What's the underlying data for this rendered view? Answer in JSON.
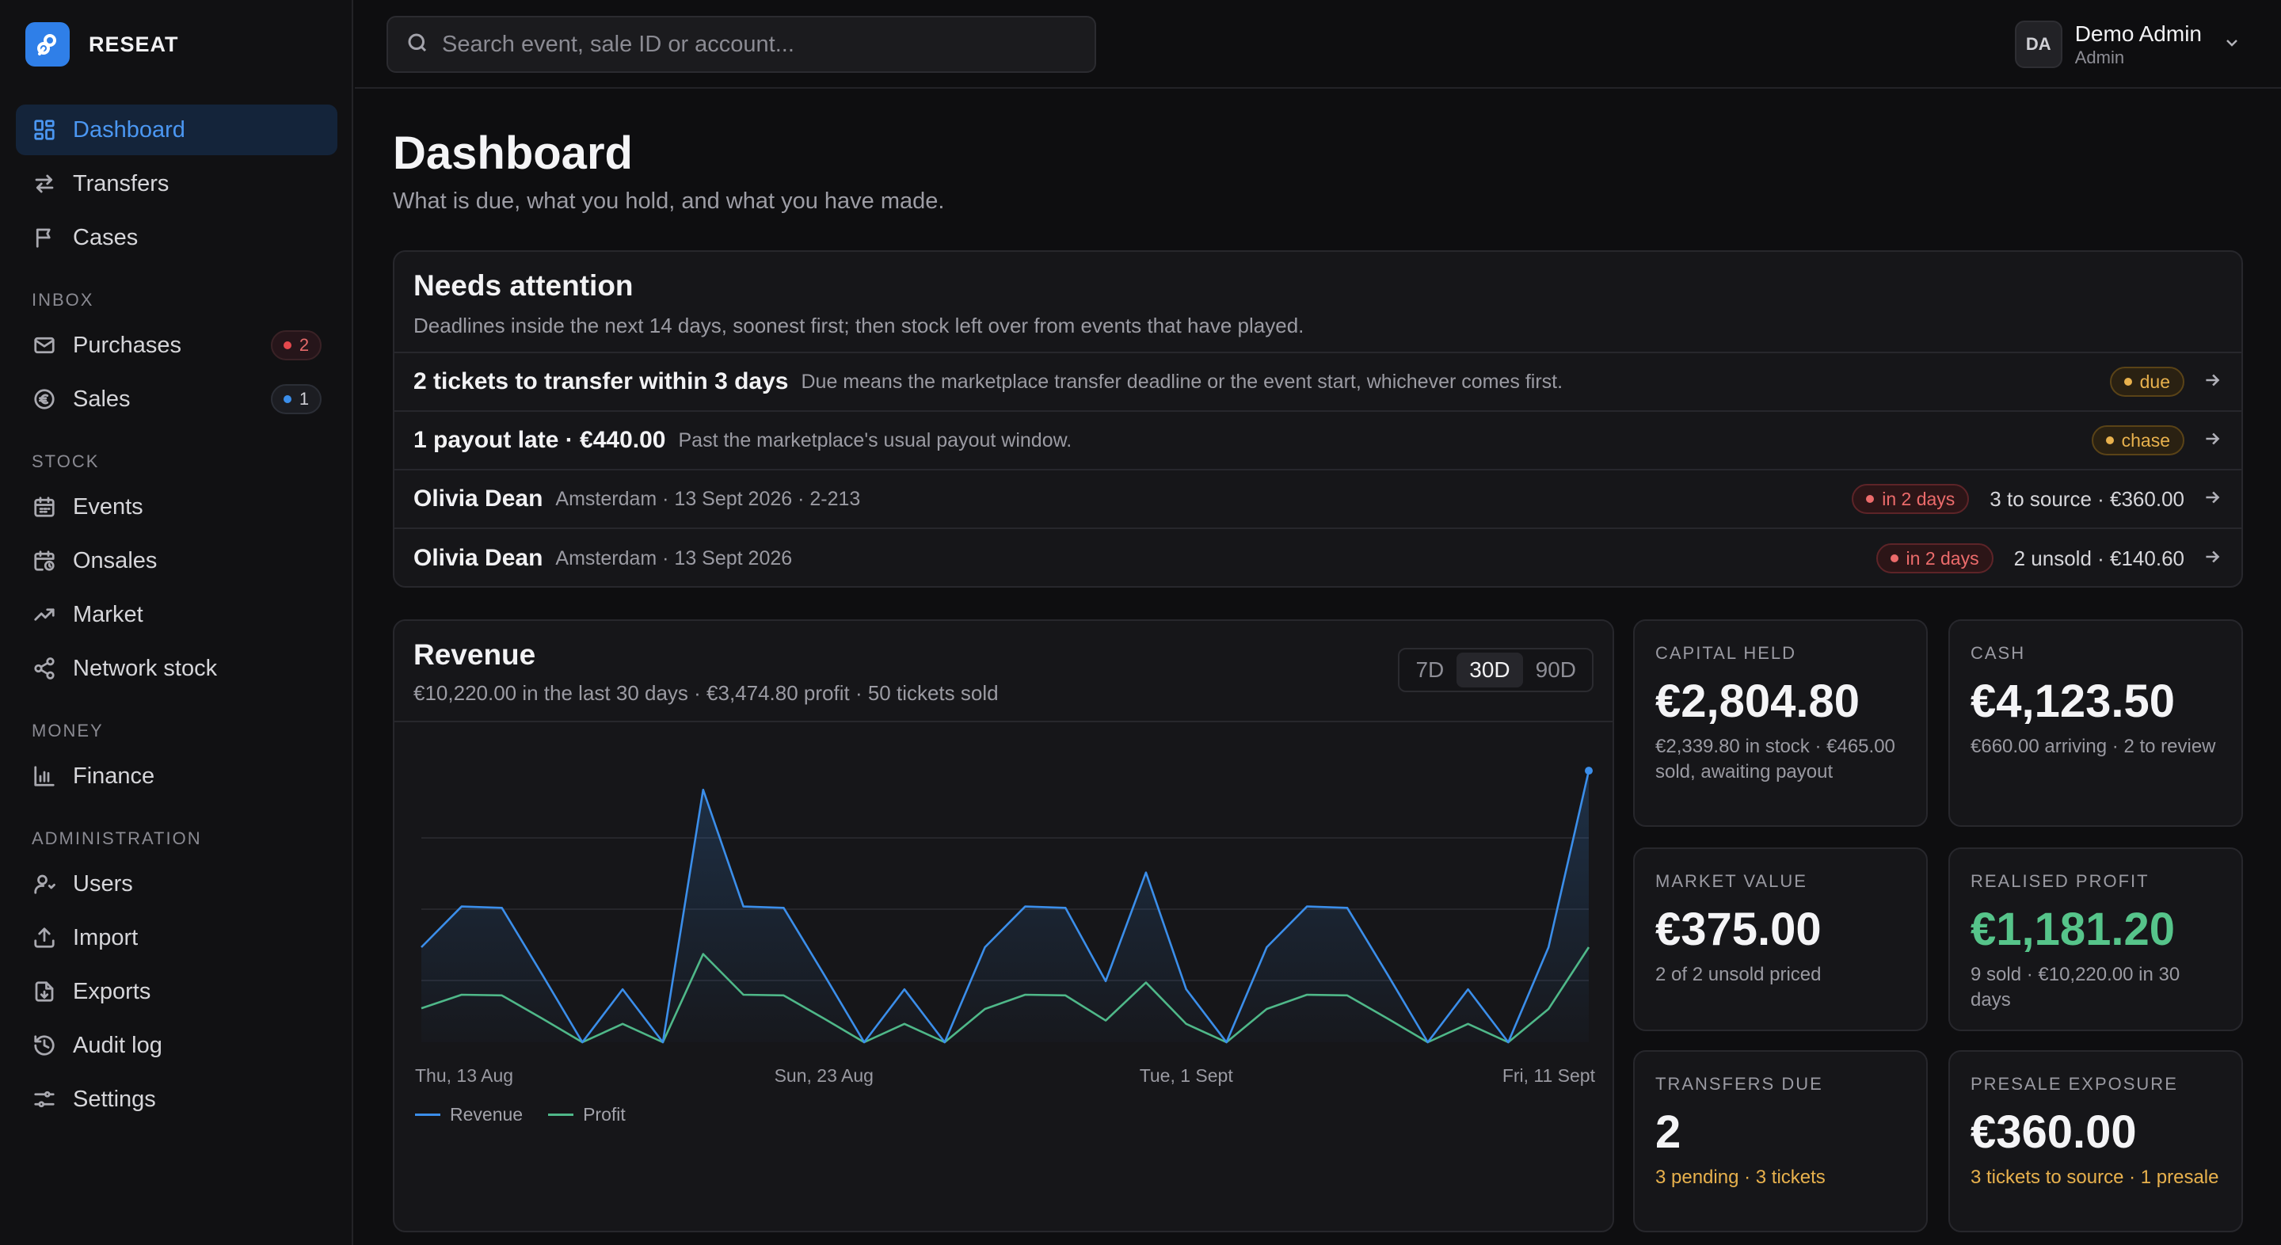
{
  "brand": {
    "name": "RESEAT"
  },
  "search": {
    "placeholder": "Search event, sale ID or account..."
  },
  "user": {
    "initials": "DA",
    "name": "Demo Admin",
    "role": "Admin"
  },
  "sidebar": {
    "top": [
      {
        "label": "Dashboard",
        "icon": "dashboard-icon",
        "active": true
      },
      {
        "label": "Transfers",
        "icon": "transfer-icon"
      },
      {
        "label": "Cases",
        "icon": "flag-icon"
      }
    ],
    "inbox_label": "INBOX",
    "inbox": [
      {
        "label": "Purchases",
        "icon": "mail-icon",
        "badge": "2",
        "badge_color": "#e5484d"
      },
      {
        "label": "Sales",
        "icon": "euro-icon",
        "badge": "1",
        "badge_color": "#3b8eea"
      }
    ],
    "stock_label": "STOCK",
    "stock": [
      {
        "label": "Events",
        "icon": "calendar-icon"
      },
      {
        "label": "Onsales",
        "icon": "calendar-clock-icon"
      },
      {
        "label": "Market",
        "icon": "trend-icon"
      },
      {
        "label": "Network stock",
        "icon": "share-icon"
      }
    ],
    "money_label": "MONEY",
    "money": [
      {
        "label": "Finance",
        "icon": "bar-chart-icon"
      }
    ],
    "admin_label": "ADMINISTRATION",
    "admin": [
      {
        "label": "Users",
        "icon": "users-icon"
      },
      {
        "label": "Import",
        "icon": "upload-icon"
      },
      {
        "label": "Exports",
        "icon": "file-icon"
      },
      {
        "label": "Audit log",
        "icon": "history-icon"
      },
      {
        "label": "Settings",
        "icon": "sliders-icon"
      }
    ]
  },
  "page": {
    "title": "Dashboard",
    "subtitle": "What is due, what you hold, and what you have made."
  },
  "attention": {
    "title": "Needs attention",
    "subtitle": "Deadlines inside the next 14 days, soonest first; then stock left over from events that have played.",
    "rows": [
      {
        "main": "2 tickets to transfer within 3 days",
        "detail": "Due means the marketplace transfer deadline or the event start, whichever comes first.",
        "pill": "due",
        "pill_color": "amber",
        "meta": ""
      },
      {
        "main": "1 payout late · €440.00",
        "detail": "Past the marketplace's usual payout window.",
        "pill": "chase",
        "pill_color": "amber",
        "meta": ""
      },
      {
        "main": "Olivia Dean",
        "detail": "Amsterdam · 13 Sept 2026 · 2-213",
        "pill": "in 2 days",
        "pill_color": "red",
        "meta": "3 to source · €360.00"
      },
      {
        "main": "Olivia Dean",
        "detail": "Amsterdam · 13 Sept 2026",
        "pill": "in 2 days",
        "pill_color": "red",
        "meta": "2 unsold · €140.60"
      }
    ]
  },
  "revenue": {
    "title": "Revenue",
    "subtitle": "€10,220.00 in the last 30 days · €3,474.80 profit · 50 tickets sold",
    "ranges": [
      "7D",
      "30D",
      "90D"
    ],
    "active_range": "30D",
    "legend": {
      "revenue": "Revenue",
      "profit": "Profit"
    }
  },
  "chart_data": {
    "type": "area",
    "x": [
      "13 Aug",
      "14 Aug",
      "15 Aug",
      "16 Aug",
      "17 Aug",
      "18 Aug",
      "19 Aug",
      "20 Aug",
      "21 Aug",
      "22 Aug",
      "23 Aug",
      "24 Aug",
      "25 Aug",
      "26 Aug",
      "27 Aug",
      "28 Aug",
      "29 Aug",
      "30 Aug",
      "31 Aug",
      "1 Sept",
      "2 Sept",
      "3 Sept",
      "4 Sept",
      "5 Sept",
      "6 Sept",
      "7 Sept",
      "8 Sept",
      "9 Sept",
      "10 Sept",
      "11 Sept",
      "12 Sept"
    ],
    "x_tick_labels": [
      "Thu, 13 Aug",
      "Sun, 23 Aug",
      "Tue, 1 Sept",
      "Fri, 11 Sept"
    ],
    "x_tick_index": [
      0,
      10,
      19,
      29
    ],
    "series": [
      {
        "name": "Revenue",
        "color": "#3b8eea",
        "values": [
          140,
          200,
          198,
          100,
          0,
          78,
          0,
          372,
          200,
          198,
          100,
          0,
          78,
          0,
          140,
          200,
          198,
          90,
          250,
          78,
          0,
          140,
          200,
          198,
          100,
          0,
          78,
          0,
          140,
          400
        ]
      },
      {
        "name": "Profit",
        "color": "#4fb889",
        "values": [
          50,
          70,
          69,
          35,
          0,
          27,
          0,
          130,
          70,
          69,
          35,
          0,
          27,
          0,
          49,
          70,
          69,
          32,
          88,
          27,
          0,
          49,
          70,
          69,
          35,
          0,
          27,
          0,
          49,
          140
        ]
      }
    ],
    "ylim": [
      0,
      420
    ],
    "grid": true,
    "legend": "bottom-left"
  },
  "stats": [
    {
      "label": "CAPITAL HELD",
      "value": "€2,804.80",
      "desc": "€2,339.80 in stock · €465.00 sold, awaiting payout",
      "value_color": "default",
      "desc_color": "default"
    },
    {
      "label": "CASH",
      "value": "€4,123.50",
      "desc": "€660.00 arriving · 2 to review",
      "value_color": "default",
      "desc_color": "default"
    },
    {
      "label": "MARKET VALUE",
      "value": "€375.00",
      "desc": "2 of 2 unsold priced",
      "value_color": "default",
      "desc_color": "default"
    },
    {
      "label": "REALISED PROFIT",
      "value": "€1,181.20",
      "desc": "9 sold · €10,220.00 in 30 days",
      "value_color": "green",
      "desc_color": "default"
    },
    {
      "label": "TRANSFERS DUE",
      "value": "2",
      "desc": "3 pending · 3 tickets",
      "value_color": "default",
      "desc_color": "amber"
    },
    {
      "label": "PRESALE EXPOSURE",
      "value": "€360.00",
      "desc": "3 tickets to source · 1 presale",
      "value_color": "default",
      "desc_color": "amber"
    }
  ]
}
